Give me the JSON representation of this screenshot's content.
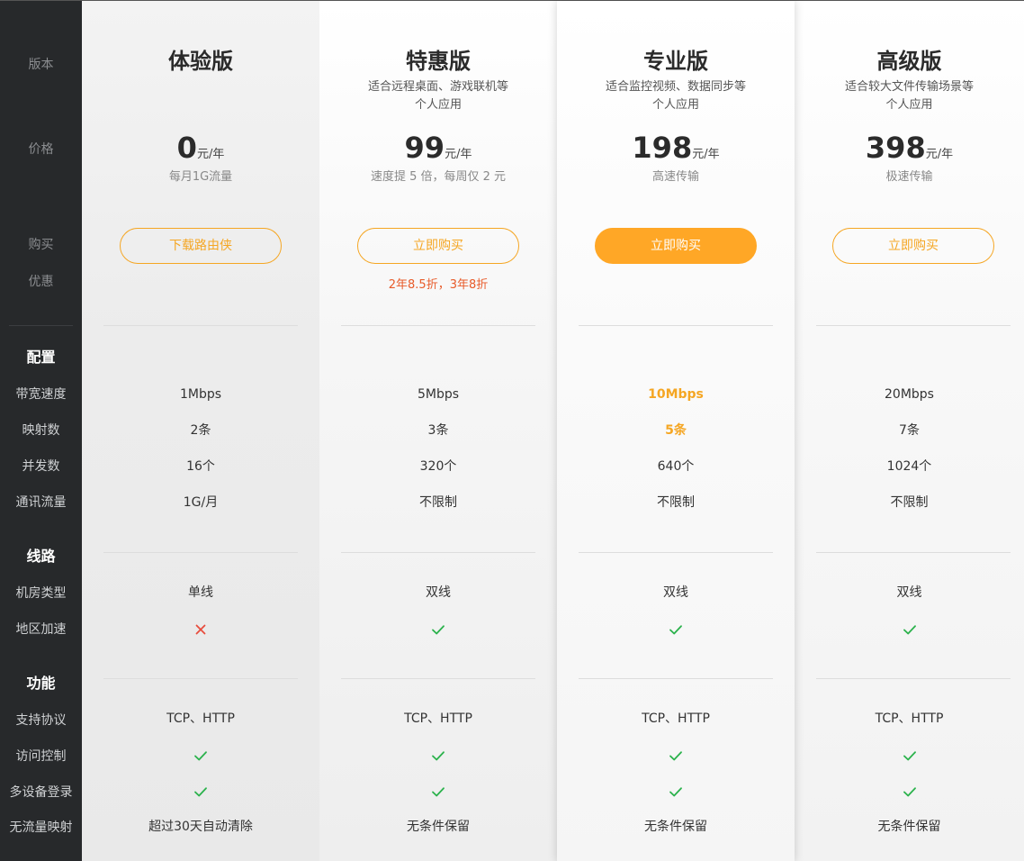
{
  "sidebar": {
    "version": "版本",
    "price": "价格",
    "buy": "购买",
    "discount": "优惠",
    "config_head": "配置",
    "bandwidth": "带宽速度",
    "mappings": "映射数",
    "concurrency": "并发数",
    "traffic": "通讯流量",
    "line_head": "线路",
    "room_type": "机房类型",
    "region_accel": "地区加速",
    "feature_head": "功能",
    "protocols": "支持协议",
    "access_control": "访问控制",
    "multi_device": "多设备登录",
    "no_traffic_mapping": "无流量映射"
  },
  "plans": [
    {
      "name": "体验版",
      "desc1": "",
      "desc2": "",
      "price": "0",
      "unit": "元/年",
      "sub": "每月1G流量",
      "button": "下载路由侠",
      "button_style": "outline",
      "promo": "",
      "bandwidth": "1Mbps",
      "mappings": "2条",
      "concurrency": "16个",
      "traffic": "1G/月",
      "room_type": "单线",
      "region_accel": "cross",
      "protocols": "TCP、HTTP",
      "access_control": "check",
      "multi_device": "check",
      "no_traffic_mapping": "超过30天自动清除"
    },
    {
      "name": "特惠版",
      "desc1": "适合远程桌面、游戏联机等",
      "desc2": "个人应用",
      "price": "99",
      "unit": "元/年",
      "sub": "速度提 5 倍，每周仅 2 元",
      "button": "立即购买",
      "button_style": "outline",
      "promo": "2年8.5折，3年8折",
      "bandwidth": "5Mbps",
      "mappings": "3条",
      "concurrency": "320个",
      "traffic": "不限制",
      "room_type": "双线",
      "region_accel": "check",
      "protocols": "TCP、HTTP",
      "access_control": "check",
      "multi_device": "check",
      "no_traffic_mapping": "无条件保留"
    },
    {
      "name": "专业版",
      "desc1": "适合监控视频、数据同步等",
      "desc2": "个人应用",
      "price": "198",
      "unit": "元/年",
      "sub": "高速传输",
      "button": "立即购买",
      "button_style": "filled",
      "promo": "",
      "bandwidth": "10Mbps",
      "mappings": "5条",
      "concurrency": "640个",
      "traffic": "不限制",
      "room_type": "双线",
      "region_accel": "check",
      "protocols": "TCP、HTTP",
      "access_control": "check",
      "multi_device": "check",
      "no_traffic_mapping": "无条件保留"
    },
    {
      "name": "高级版",
      "desc1": "适合较大文件传输场景等",
      "desc2": "个人应用",
      "price": "398",
      "unit": "元/年",
      "sub": "极速传输",
      "button": "立即购买",
      "button_style": "outline",
      "promo": "",
      "bandwidth": "20Mbps",
      "mappings": "7条",
      "concurrency": "1024个",
      "traffic": "不限制",
      "room_type": "双线",
      "region_accel": "check",
      "protocols": "TCP、HTTP",
      "access_control": "check",
      "multi_device": "check",
      "no_traffic_mapping": "无条件保留"
    }
  ],
  "colors": {
    "accent": "#f5a623",
    "accent_filled": "#ffa726",
    "check": "#2bb24c",
    "cross": "#e84c3d",
    "promo": "#e85b2a",
    "sidebar_bg": "#27292b"
  }
}
